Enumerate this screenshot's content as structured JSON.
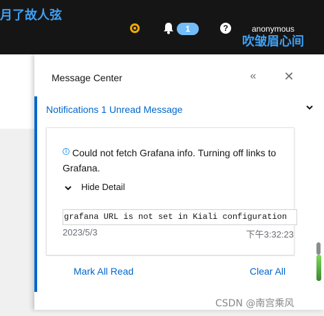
{
  "watermark": {
    "top_left": "月了故人弦",
    "top_right": "吹皱眉心间",
    "bottom_right": "CSDN @南宫乘风"
  },
  "header": {
    "notification_count": "1",
    "help_glyph": "?",
    "user": "anonymous"
  },
  "drawer": {
    "title": "Message Center",
    "collapse_glyph": "«",
    "close_glyph": "✕",
    "section": {
      "title": "Notifications 1 Unread Message",
      "message": {
        "info_glyph": "i",
        "text": "Could not fetch Grafana info. Turning off links to Grafana.",
        "toggle_label": "Hide Detail",
        "detail": "grafana URL is not set in Kiali configuration",
        "date": "2023/5/3",
        "time": "下午3:32:23"
      },
      "footer": {
        "mark_all_read": "Mark All Read",
        "clear_all": "Clear All"
      }
    }
  },
  "colors": {
    "accent": "#0066cc",
    "info": "#2b9af3",
    "badge": "#73bcf7",
    "status_dot": "#f0ab00",
    "watermark": "#3ea0f4",
    "topbar": "#151515"
  },
  "icons": {
    "status": "status-dot-icon",
    "bell": "bell-icon",
    "help": "question-circle-icon",
    "collapse": "double-chevron-left-icon",
    "close": "close-icon",
    "section_toggle": "chevron-down-icon",
    "info": "info-circle-icon",
    "detail_toggle": "chevron-down-icon"
  }
}
